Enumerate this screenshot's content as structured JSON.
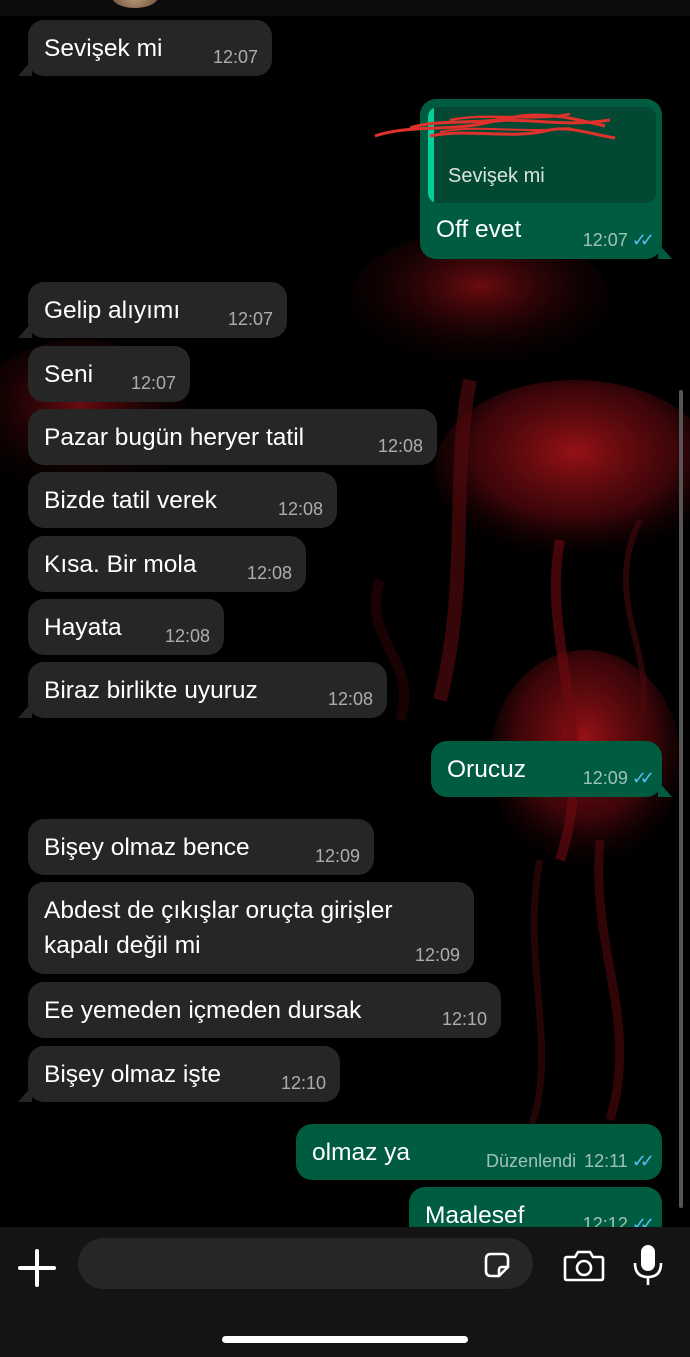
{
  "colors": {
    "incoming_bubble": "#262626",
    "outgoing_bubble": "#005c40",
    "read_ticks": "#53bdeb",
    "wallpaper_accent": "#b0141a"
  },
  "icons": {
    "read_receipt": "double-check-icon",
    "attach": "plus-icon",
    "sticker": "sticker-icon",
    "camera": "camera-icon",
    "mic": "microphone-icon"
  },
  "messages": [
    {
      "text": "Sevişek mi",
      "time": "12:07"
    },
    {
      "text": "Off evet",
      "time": "12:07",
      "reply_to": "Sevişek mi"
    },
    {
      "text": "Gelip alıyımı",
      "time": "12:07"
    },
    {
      "text": "Seni",
      "time": "12:07"
    },
    {
      "text": "Pazar bugün heryer tatil",
      "time": "12:08"
    },
    {
      "text": "Bizde tatil verek",
      "time": "12:08"
    },
    {
      "text": "Kısa. Bir mola",
      "time": "12:08"
    },
    {
      "text": "Hayata",
      "time": "12:08"
    },
    {
      "text": "Biraz birlikte uyuruz",
      "time": "12:08"
    },
    {
      "text": "Orucuz",
      "time": "12:09"
    },
    {
      "text": "Bişey olmaz bence",
      "time": "12:09"
    },
    {
      "text_line1": "Abdest de çıkışlar oruçta girişler",
      "text_line2": "kapalı değil mi",
      "time": "12:09"
    },
    {
      "text": "Ee yemeden içmeden dursak",
      "time": "12:10"
    },
    {
      "text": "Bişey olmaz işte",
      "time": "12:10"
    },
    {
      "text": "olmaz ya",
      "time": "12:11",
      "edited_label": "Düzenlendi"
    },
    {
      "text": "Maalesef",
      "time": "12:12"
    }
  ]
}
